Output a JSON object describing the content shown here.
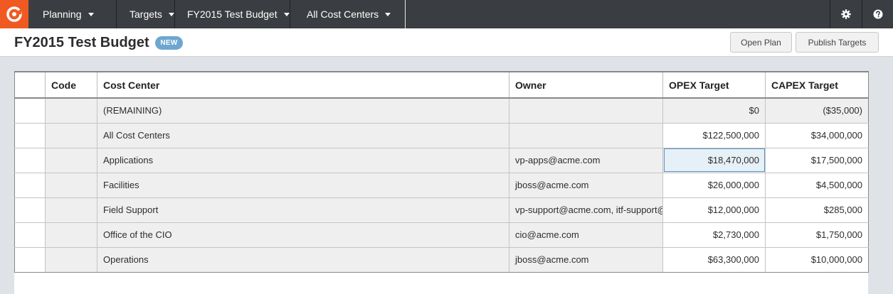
{
  "nav": {
    "items": [
      {
        "label": "Planning"
      },
      {
        "label": "Targets"
      },
      {
        "label": "FY2015 Test Budget"
      },
      {
        "label": "All Cost Centers"
      }
    ],
    "icons": [
      "logo-icon",
      "gear-icon",
      "help-icon"
    ]
  },
  "header": {
    "title": "FY2015 Test Budget",
    "badge": "NEW",
    "open_plan_label": "Open Plan",
    "publish_targets_label": "Publish Targets"
  },
  "table": {
    "columns": [
      "Code",
      "Cost Center",
      "Owner",
      "OPEX Target",
      "CAPEX Target"
    ],
    "rows": [
      {
        "code": "",
        "cost_center": "(REMAINING)",
        "owner": "",
        "opex": "$0",
        "capex": "($35,000)"
      },
      {
        "code": "",
        "cost_center": "All Cost Centers",
        "owner": "",
        "opex": "$122,500,000",
        "capex": "$34,000,000"
      },
      {
        "code": "",
        "cost_center": "Applications",
        "owner": "vp-apps@acme.com",
        "opex": "$18,470,000",
        "capex": "$17,500,000"
      },
      {
        "code": "",
        "cost_center": "Facilities",
        "owner": "jboss@acme.com",
        "opex": "$26,000,000",
        "capex": "$4,500,000"
      },
      {
        "code": "",
        "cost_center": "Field Support",
        "owner": "vp-support@acme.com, itf-support@",
        "opex": "$12,000,000",
        "capex": "$285,000"
      },
      {
        "code": "",
        "cost_center": "Office of the CIO",
        "owner": "cio@acme.com",
        "opex": "$2,730,000",
        "capex": "$1,750,000"
      },
      {
        "code": "",
        "cost_center": "Operations",
        "owner": "jboss@acme.com",
        "opex": "$63,300,000",
        "capex": "$10,000,000"
      }
    ]
  },
  "colors": {
    "nav_bg": "#3a3d41",
    "brand": "#f05a22",
    "badge": "#6ea6cf",
    "selection": "#e6f0f7"
  }
}
